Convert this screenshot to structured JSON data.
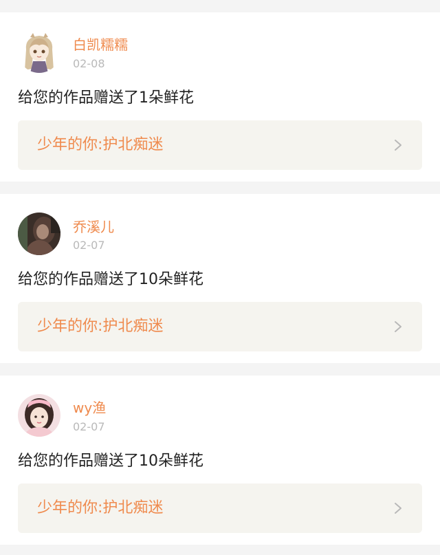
{
  "gifts": [
    {
      "username": "白凯糯糯",
      "date": "02-08",
      "message": "给您的作品赠送了1朵鲜花",
      "work_title": "少年的你:护北痴迷"
    },
    {
      "username": "乔溪儿",
      "date": "02-07",
      "message": "给您的作品赠送了10朵鲜花",
      "work_title": "少年的你:护北痴迷"
    },
    {
      "username": "wy渔",
      "date": "02-07",
      "message": "给您的作品赠送了10朵鲜花",
      "work_title": "少年的你:护北痴迷"
    }
  ],
  "colors": {
    "accent": "#ef8a4d",
    "date_text": "#b9b9b9",
    "work_bg": "#f5f4ef",
    "separator": "#f4f4f4"
  },
  "icons": {
    "avatar_1": "anime-girl-avatar",
    "avatar_2": "dark-photo-avatar",
    "avatar_3": "pink-girl-avatar",
    "chevron": "chevron-right-icon"
  }
}
